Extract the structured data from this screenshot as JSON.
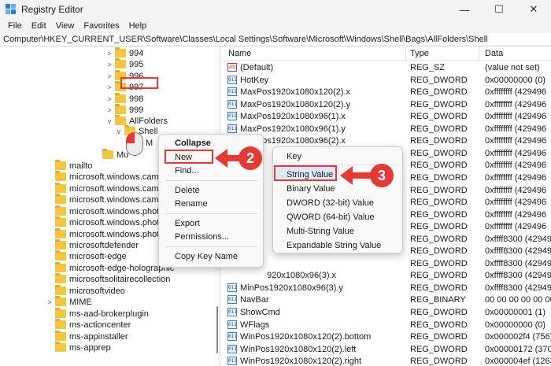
{
  "window": {
    "title": "Registry Editor",
    "minimize_glyph": "—",
    "maximize_glyph": "☐",
    "close_glyph": "✕"
  },
  "menu": [
    "File",
    "Edit",
    "View",
    "Favorites",
    "Help"
  ],
  "address": "Computer\\HKEY_CURRENT_USER\\Software\\Classes\\Local Settings\\Software\\Microsoft\\Windows\\Shell\\Bags\\AllFolders\\Shell",
  "tree": {
    "numbered_keys": [
      "994",
      "995",
      "996",
      "997",
      "998",
      "999"
    ],
    "allfolders": "AllFolders",
    "shell": "Shell",
    "shell_suffix": "M",
    "mu_partial": "Mu",
    "lower_keys": [
      "mailto",
      "microsoft.windows.came",
      "microsoft.windows.came",
      "microsoft.windows.came",
      "microsoft.windows.photo",
      "microsoft.windows.photo",
      "microsoft.windows.photo",
      "microsoftdefender",
      "microsoft-edge",
      "microsoft-edge-holographic",
      "microsoftsolitairecollection",
      "microsoftvideo",
      "MIME",
      "ms-aad-brokerplugin",
      "ms-actioncenter",
      "ms-appinstaller",
      "ms-apprep"
    ]
  },
  "values_pane": {
    "headers": {
      "name": "Name",
      "type": "Type",
      "data": "Data"
    },
    "rows": [
      {
        "name": "(Default)",
        "type": "REG_SZ",
        "data": "(value not set)",
        "icon": "ab"
      },
      {
        "name": "HotKey",
        "type": "REG_DWORD",
        "data": "0x00000000 (0)",
        "icon": "011"
      },
      {
        "name": "MaxPos1920x1080x120(2).x",
        "type": "REG_DWORD",
        "data": "0xffffffff (429496",
        "icon": "011"
      },
      {
        "name": "MaxPos1920x1080x120(2).y",
        "type": "REG_DWORD",
        "data": "0xffffffff (429496",
        "icon": "011"
      },
      {
        "name": "MaxPos1920x1080x96(1).x",
        "type": "REG_DWORD",
        "data": "0xffffffff (429496",
        "icon": "011"
      },
      {
        "name": "MaxPos1920x1080x96(1).y",
        "type": "REG_DWORD",
        "data": "0xffffffff (429496",
        "icon": "011"
      },
      {
        "name": "MaxPos1920x1080x96(2).x",
        "type": "REG_DWORD",
        "data": "0xffffffff (429496",
        "icon": "011"
      },
      {
        "name": "",
        "type": "REG_DWORD",
        "data": "0xffffffff (429496",
        "icon": ""
      },
      {
        "name": "",
        "type": "REG_DWORD",
        "data": "0xffffffff (429496",
        "icon": ""
      },
      {
        "name": "",
        "type": "REG_DWORD",
        "data": "0xffffffff (429496",
        "icon": ""
      },
      {
        "name": "",
        "type": "REG_DWORD",
        "data": "0xffffffff (429496",
        "icon": ""
      },
      {
        "name": "",
        "type": "REG_DWORD",
        "data": "0xffffffff (429496",
        "icon": ""
      },
      {
        "name": "",
        "type": "REG_DWORD",
        "data": "0xffffffff (429496",
        "icon": ""
      },
      {
        "name": "",
        "type": "REG_DWORD",
        "data": "0xffffffff (429496",
        "icon": ""
      },
      {
        "name": "",
        "type": "REG_DWORD",
        "data": "0xffff8300 (42949",
        "icon": ""
      },
      {
        "name": "",
        "type": "REG_DWORD",
        "data": "0xffff8300 (42949",
        "icon": ""
      },
      {
        "name": "",
        "type": "REG_DWORD",
        "data": "0xffff8300 (42949",
        "icon": ""
      },
      {
        "name": "920x1080x96(3).x",
        "type": "REG_DWORD",
        "data": "0xffff8300 (42949",
        "icon": ""
      },
      {
        "name": "MinPos1920x1080x96(3).y",
        "type": "REG_DWORD",
        "data": "0xffff8300 (42949",
        "icon": "011"
      },
      {
        "name": "NavBar",
        "type": "REG_BINARY",
        "data": "00 00 00 00 00 00",
        "icon": "011"
      },
      {
        "name": "ShowCmd",
        "type": "REG_DWORD",
        "data": "0x00000001 (1)",
        "icon": "011"
      },
      {
        "name": "WFlags",
        "type": "REG_DWORD",
        "data": "0x00000000 (0)",
        "icon": "011"
      },
      {
        "name": "WinPos1920x1080x120(2).bottom",
        "type": "REG_DWORD",
        "data": "0x000002f4 (756)",
        "icon": "011"
      },
      {
        "name": "WinPos1920x1080x120(2).left",
        "type": "REG_DWORD",
        "data": "0x00000172 (370",
        "icon": "011"
      },
      {
        "name": "WinPos1920x1080x120(2).right",
        "type": "REG_DWORD",
        "data": "0x000004ef (1263",
        "icon": "011"
      },
      {
        "name": "WinPos1920x1080x120(2).top",
        "type": "REG_DWORD",
        "data": "0x000000d0 (208",
        "icon": "011"
      }
    ]
  },
  "context_menu": {
    "items": [
      "Collapse",
      "New",
      "Find...",
      "Delete",
      "Rename",
      "Export",
      "Permissions...",
      "Copy Key Name"
    ],
    "submenu_arrow": "›"
  },
  "new_submenu": {
    "items": [
      "Key",
      "String Value",
      "Binary Value",
      "DWORD (32-bit) Value",
      "QWORD (64-bit) Value",
      "Multi-String Value",
      "Expandable String Value"
    ]
  },
  "callouts": {
    "step2": "2",
    "step3": "3"
  },
  "colors": {
    "highlight": "#e53935",
    "folder": "#f4c542"
  }
}
